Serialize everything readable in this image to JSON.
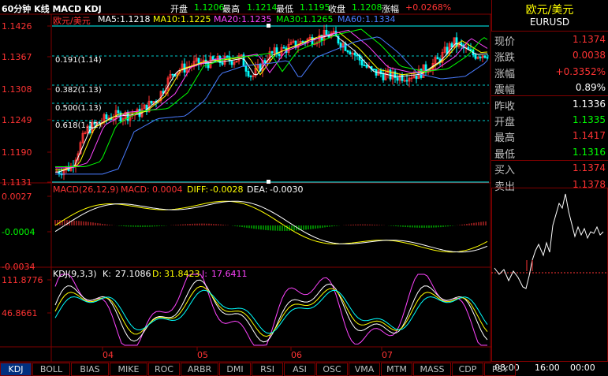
{
  "header": {
    "title": "60分钟 K线 MACD KDJ",
    "open_label": "开盘",
    "open_value": "1.1206",
    "high_label": "最高",
    "high_value": "1.1214",
    "low_label": "最低",
    "low_value": "1.1195",
    "close_label": "收盘",
    "close_value": "1.1208",
    "change_label": "涨幅",
    "change_value": "+0.0268%"
  },
  "main_panel": {
    "symbol": "欧元/美元",
    "ma5_label": "MA5:",
    "ma5": "1.1218",
    "ma10_label": "MA10:",
    "ma10": "1.1225",
    "ma20_label": "MA20:",
    "ma20": "1.1235",
    "ma30_label": "MA30:",
    "ma30": "1.1265",
    "ma60_label": "MA60:",
    "ma60": "1.1334",
    "y_ticks": [
      "1.1426",
      "1.1367",
      "1.1308",
      "1.1249",
      "1.1190",
      "1.1131"
    ],
    "fib": [
      "0.191(1.14)",
      "0.382(1.13)",
      "0.500(1.13)",
      "0.618(1.12)"
    ]
  },
  "macd_panel": {
    "label": "MACD(26,12,9)",
    "macd_label": "MACD:",
    "macd": "0.0004",
    "diff_label": "DIFF:",
    "diff": "-0.0028",
    "dea_label": "DEA:",
    "dea": "-0.0030",
    "y_ticks": [
      "0.0027",
      "-0.0004",
      "-0.0034"
    ]
  },
  "kdj_panel": {
    "label": "KDJ(9,3,3)",
    "k_label": "K:",
    "k": "27.1086",
    "d_label": "D:",
    "d": "31.8423",
    "j_label": "J:",
    "j": "17.6411",
    "y_ticks": [
      "111.8776",
      "46.8661"
    ]
  },
  "x_axis": [
    "04",
    "05",
    "06",
    "07"
  ],
  "quote": {
    "name": "欧元/美元",
    "code": "EURUSD",
    "rows": [
      {
        "k": "现价",
        "v": "1.1374",
        "c": "#ff3333"
      },
      {
        "k": "涨跌",
        "v": "0.0038",
        "c": "#ff3333"
      },
      {
        "k": "涨幅",
        "v": "+0.3352%",
        "c": "#ff3333"
      },
      {
        "k": "震幅",
        "v": "0.89%",
        "c": "#ffffff"
      },
      {
        "k": "昨收",
        "v": "1.1336",
        "c": "#ffffff"
      },
      {
        "k": "开盘",
        "v": "1.1335",
        "c": "#00ff00"
      },
      {
        "k": "最高",
        "v": "1.1417",
        "c": "#ff3333"
      },
      {
        "k": "最低",
        "v": "1.1316",
        "c": "#00ff00"
      },
      {
        "k": "买入",
        "v": "1.1374",
        "c": "#ff3333"
      },
      {
        "k": "卖出",
        "v": "1.1378",
        "c": "#ff3333"
      }
    ],
    "time_ticks": [
      "08:00",
      "16:00",
      "00:00"
    ]
  },
  "tabs": [
    "KDJ",
    "BOLL",
    "BIAS",
    "MIKE",
    "ROC",
    "ARBR",
    "DMI",
    "RSI",
    "ASI",
    "OSC",
    "VMA",
    "MTM",
    "MASS",
    "CDP",
    "PSY"
  ],
  "active_tab": "KDJ",
  "colors": {
    "up": "#ff3333",
    "down": "#00ffff",
    "grid": "#800000",
    "ma5": "#ffffff",
    "ma10": "#ffff00",
    "ma20": "#ff44ff",
    "ma30": "#00ff00",
    "ma60": "#4a7cff"
  }
}
